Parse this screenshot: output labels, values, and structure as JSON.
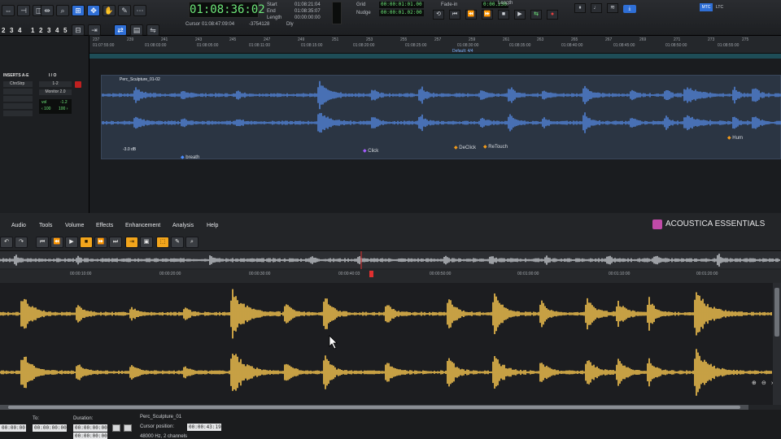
{
  "daw": {
    "main_counter": "01:08:36:02",
    "cursor_label": "Cursor",
    "cursor_value": "01:08:47:09:04",
    "start_label": "Start",
    "start_value": "01:08:21:04",
    "end_label": "End",
    "end_value": "01:08:35:07",
    "length_label": "Length",
    "length_value": "00:00:00:00",
    "sample_value": "-3754128",
    "dly_label": "Dly",
    "grid_label": "Grid",
    "grid_value": "00:00:01:01.00",
    "nudge_label": "Nudge",
    "nudge_value": "00:00:01.02:00",
    "fade_label": "Fade-in",
    "fade_value": "0:00.230",
    "length2_label": "Length",
    "track_numbers": [
      "2",
      "3",
      "4",
      "1",
      "2",
      "3",
      "4",
      "5"
    ],
    "mtc_label": "MTC",
    "ltc_label": "LTC",
    "default_label": "Default: 4/4",
    "ruler_bars": [
      "237",
      "239",
      "241",
      "243",
      "245",
      "247",
      "249",
      "251",
      "253",
      "255",
      "257",
      "259",
      "261",
      "263",
      "265",
      "267",
      "269",
      "271",
      "273",
      "275"
    ],
    "ruler_times": [
      "01:07:55:00",
      "01:08:03:00",
      "01:08:05:00",
      "01:08:11:00",
      "01:08:15:00",
      "01:08:20:00",
      "01:08:25:00",
      "01:08:30:00",
      "01:08:35:00",
      "01:08:40:00",
      "01:08:45:00",
      "01:08:50:00",
      "01:08:55:00"
    ],
    "inserts_header": "INSERTS A-E",
    "io_header": "I / O",
    "insert_slot": "ChnStrp",
    "io_input": "1-2",
    "io_output": "Monitor 2.0",
    "vol_label": "vol",
    "vol_value": "-1.2",
    "pan_left": "‹ 100",
    "pan_right": "100 ›",
    "clip_name": "Perc_Sculpture_01-02",
    "clip_gain": "-3.0 dB",
    "markers": [
      {
        "name": "breath",
        "color": "#4a8cff"
      },
      {
        "name": "Click",
        "color": "#a45cff"
      },
      {
        "name": "DeClick",
        "color": "#f29a1a"
      },
      {
        "name": "ReTouch",
        "color": "#f29a1a"
      },
      {
        "name": "Hum",
        "color": "#f29a1a"
      }
    ],
    "wave_color": "#4f7fd0"
  },
  "acoustica": {
    "menu": [
      "Audio",
      "Tools",
      "Volume",
      "Effects",
      "Enhancement",
      "Analysis",
      "Help"
    ],
    "brand": "ACOUSTICA ESSENTIALS",
    "ruler_times": [
      "00:00:10:00",
      "00:00:20:00",
      "00:00:30:00",
      "00:00:40:03",
      "00:00:50:00",
      "00:01:00:00",
      "00:01:10:00",
      "00:01:20:00"
    ],
    "wave_color": "#f2c14e",
    "overview_color": "#b9bcc1",
    "status": {
      "to_label": "To:",
      "to_value": "00:00:00:00",
      "duration_label": "Duration:",
      "duration_value": "00:00:00:00",
      "duration_value2": "00:00:00:00",
      "from_value": "00:00:00:00",
      "file_name": "Perc_Sculpture_01",
      "cursor_label": "Cursor position:",
      "cursor_value": "00:00:43:19",
      "format_text": "48000 Hz, 2 channels"
    }
  }
}
